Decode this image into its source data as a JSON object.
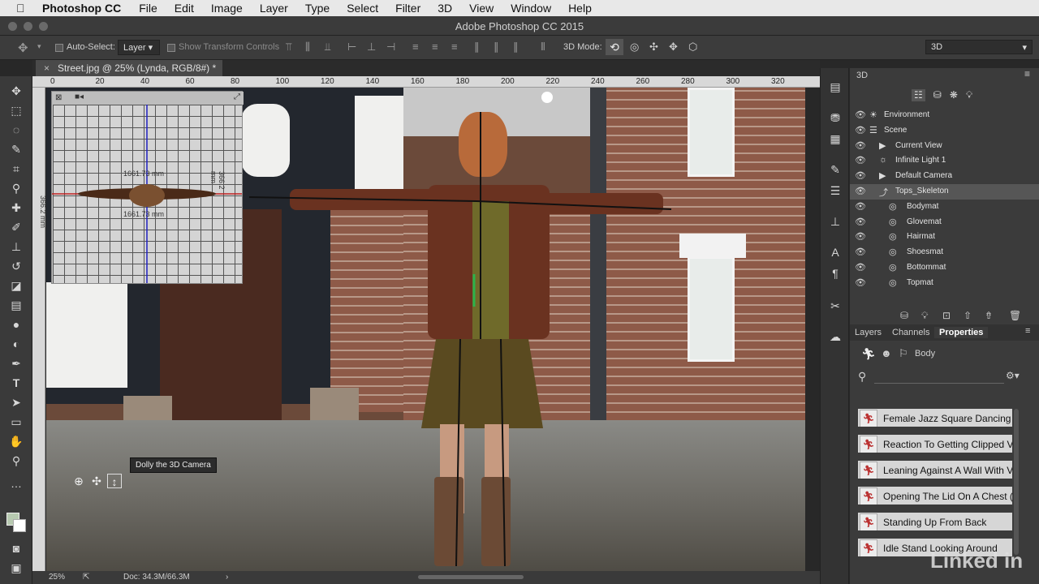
{
  "menubar": {
    "app_name": "Photoshop CC",
    "items": [
      "File",
      "Edit",
      "Image",
      "Layer",
      "Type",
      "Select",
      "Filter",
      "3D",
      "View",
      "Window",
      "Help"
    ]
  },
  "window": {
    "title": "Adobe Photoshop CC 2015"
  },
  "options_bar": {
    "auto_select_label": "Auto-Select:",
    "auto_select_value": "Layer",
    "show_transform_label": "Show Transform Controls",
    "mode_label": "3D Mode:",
    "workspace_value": "3D"
  },
  "document": {
    "tab_title": "Street.jpg @ 25% (Lynda, RGB/8#) *",
    "close_glyph": "×"
  },
  "ruler": {
    "h_ticks": [
      "0",
      "20",
      "40",
      "60",
      "80",
      "100",
      "120",
      "140",
      "160",
      "180",
      "200",
      "220",
      "240",
      "260",
      "280",
      "300",
      "320"
    ]
  },
  "preview": {
    "measure_top": "1661.73 mm",
    "measure_bottom": "1661.73 mm",
    "measure_left": "366.2 mm",
    "measure_right": "366.2 mm"
  },
  "tooltip": {
    "text": "Dolly the 3D Camera"
  },
  "status": {
    "zoom": "25%",
    "doc": "Doc: 34.3M/66.3M"
  },
  "panel_3d": {
    "title": "3D",
    "rows": [
      {
        "label": "Environment",
        "indent": 0,
        "selected": false
      },
      {
        "label": "Scene",
        "indent": 0,
        "selected": false
      },
      {
        "label": "Current View",
        "indent": 1,
        "selected": false
      },
      {
        "label": "Infinite Light 1",
        "indent": 1,
        "selected": false
      },
      {
        "label": "Default Camera",
        "indent": 1,
        "selected": false
      },
      {
        "label": "Tops_Skeleton",
        "indent": 1,
        "selected": true
      },
      {
        "label": "Bodymat",
        "indent": 2,
        "selected": false
      },
      {
        "label": "Glovemat",
        "indent": 2,
        "selected": false
      },
      {
        "label": "Hairmat",
        "indent": 2,
        "selected": false
      },
      {
        "label": "Shoesmat",
        "indent": 2,
        "selected": false
      },
      {
        "label": "Bottommat",
        "indent": 2,
        "selected": false
      },
      {
        "label": "Topmat",
        "indent": 2,
        "selected": false
      }
    ]
  },
  "lower_panel": {
    "tabs": [
      "Layers",
      "Channels",
      "Properties"
    ],
    "active_tab": "Properties",
    "properties_label": "Body",
    "animations": [
      "Female Jazz Square Dancing",
      "Reaction To Getting Clipped V",
      "Leaning Against A Wall With V",
      "Opening The Lid On A Chest (",
      "Standing Up From Back",
      "Idle Stand Looking Around"
    ]
  },
  "watermark": "Linked in"
}
